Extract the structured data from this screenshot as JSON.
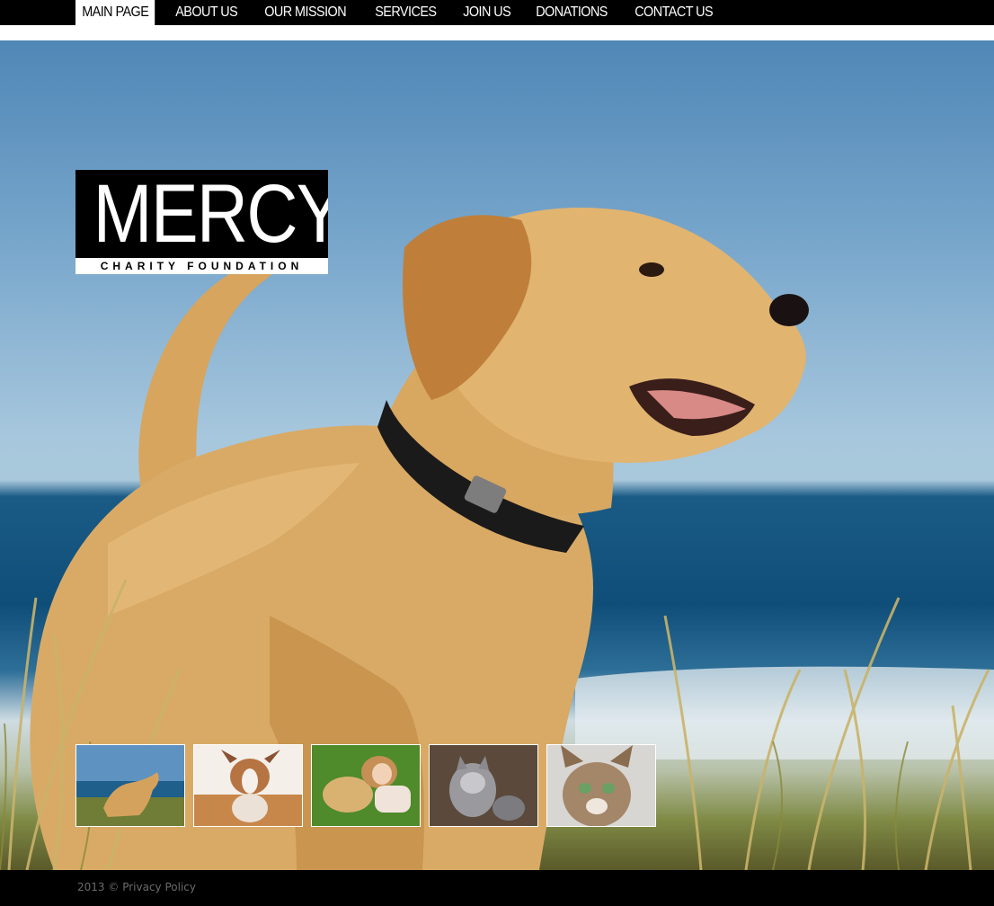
{
  "nav": {
    "items": [
      {
        "label": "MAIN PAGE",
        "active": true
      },
      {
        "label": "ABOUT US",
        "active": false
      },
      {
        "label": "OUR MISSION",
        "active": false
      },
      {
        "label": "SERVICES",
        "active": false
      },
      {
        "label": "JOIN US",
        "active": false
      },
      {
        "label": "DONATIONS",
        "active": false
      },
      {
        "label": "CONTACT US",
        "active": false
      }
    ]
  },
  "logo": {
    "title": "MERCY",
    "subtitle": "CHARITY FOUNDATION"
  },
  "hero": {
    "image": "golden-retriever-puppy-on-beach"
  },
  "thumbnails": [
    {
      "image": "puppy-on-beach"
    },
    {
      "image": "chihuahua-puppy-in-basket"
    },
    {
      "image": "girl-with-dog-on-grass"
    },
    {
      "image": "gray-kittens"
    },
    {
      "image": "tabby-cat"
    }
  ],
  "footer": {
    "year": "2013",
    "copyright_symbol": "©",
    "privacy_link": "Privacy Policy"
  },
  "colors": {
    "nav_bg": "#000000",
    "footer_bg": "#000000",
    "footer_text": "#6b6b6b"
  }
}
